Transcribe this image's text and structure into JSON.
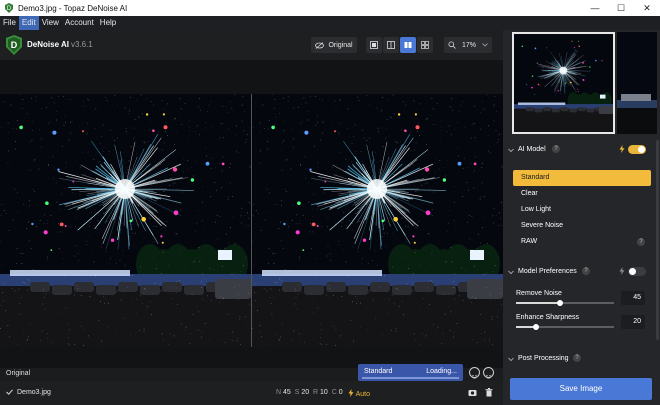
{
  "window": {
    "title": "Demo3.jpg - Topaz DeNoise AI",
    "controls": [
      "—",
      "☐",
      "✕"
    ]
  },
  "menu": {
    "items": [
      {
        "label": "File",
        "active": false
      },
      {
        "label": "Edit",
        "active": true
      },
      {
        "label": "View",
        "active": false
      },
      {
        "label": "Account",
        "active": false
      },
      {
        "label": "Help",
        "active": false
      }
    ]
  },
  "toolbar": {
    "app_name": "DeNoise AI",
    "version": "v3.6.1",
    "original_label": "Original",
    "zoom": "17%",
    "view_modes": [
      "single-view",
      "split-view",
      "side-by-side-view",
      "quad-view"
    ],
    "selected_view": "side-by-side-view"
  },
  "viewer": {
    "left_label": "Original",
    "progress_model": "Standard",
    "progress_status": "Loading...",
    "progress_fraction": 0.0
  },
  "footer": {
    "filename": "Demo3.jpg",
    "stats": [
      {
        "k": "N",
        "v": "45"
      },
      {
        "k": "S",
        "v": "20"
      },
      {
        "k": "R",
        "v": "10"
      },
      {
        "k": "C",
        "v": "0"
      }
    ],
    "auto_label": "Auto"
  },
  "sidebar": {
    "ai_model": {
      "title": "AI Model",
      "help": "?",
      "auto_enabled": true,
      "modes": [
        {
          "label": "Standard",
          "selected": true
        },
        {
          "label": "Clear",
          "selected": false
        },
        {
          "label": "Low Light",
          "selected": false
        },
        {
          "label": "Severe Noise",
          "selected": false
        },
        {
          "label": "RAW",
          "selected": false
        }
      ],
      "raw_help": "?"
    },
    "model_preferences": {
      "title": "Model Preferences",
      "help": "?",
      "auto_enabled": false,
      "remove_noise_label": "Remove Noise",
      "remove_noise_value": "45",
      "remove_noise_level": 0.45,
      "enhance_sharpness_label": "Enhance Sharpness",
      "enhance_sharpness_value": "20",
      "enhance_sharpness_level": 0.2
    },
    "post_processing": {
      "title": "Post Processing",
      "help": "?"
    },
    "save_label": "Save Image"
  },
  "colors": {
    "accent_blue": "#4a78d6",
    "accent_yellow": "#f2bb3c",
    "panel_bg": "#25262a",
    "viewer_bg": "#121314"
  }
}
